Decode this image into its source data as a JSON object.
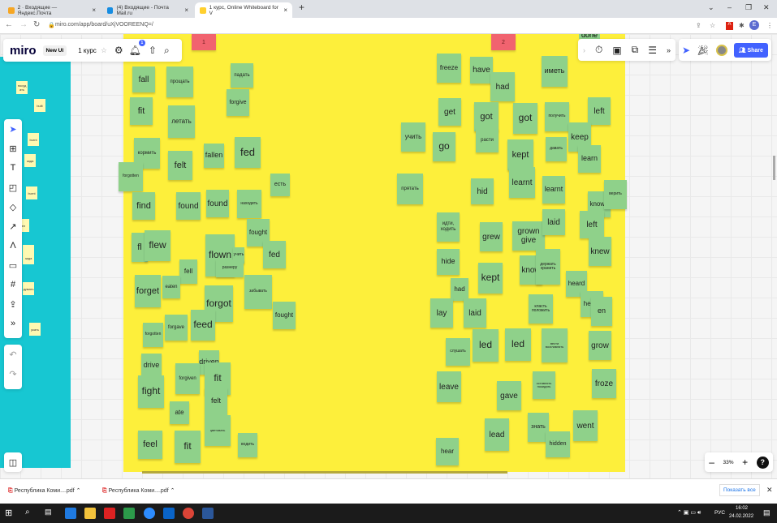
{
  "browser": {
    "tabs": [
      {
        "label": "2 · Входящие — Яндекс.Почта"
      },
      {
        "label": "(4) Входящие - Почта Mail.ru"
      },
      {
        "label": "1 курс, Online Whiteboard for V"
      }
    ],
    "url": "miro.com/app/board/uXjVOOREENQ=/",
    "profile_initial": "E"
  },
  "miro": {
    "logo": "miro",
    "badge": "New UI",
    "board_name": "1 курс",
    "notification_count": "1",
    "share_label": "Share",
    "zoom": "33%",
    "help": "?"
  },
  "frames": {
    "red1": "1",
    "red2": "2",
    "done": "done"
  },
  "stickies": [
    "fall",
    "прощать",
    "падать",
    "forgive",
    "fit",
    "летать",
    "кормить",
    "felt",
    "fallen",
    "fed",
    "forgotten",
    "есть",
    "find",
    "found",
    "found",
    "находить",
    "fought",
    "fl",
    "flew",
    "flown",
    "учить",
    "fed",
    "разнеру",
    "fell",
    "forget",
    "eaten",
    "забывать",
    "forgot",
    "fought",
    "forgave",
    "feed",
    "forgotten",
    "drive",
    "driven",
    "fight",
    "forgiven",
    "fit",
    "felt",
    "ate",
    "цветовать",
    "feel",
    "fit",
    "водить",
    "freeze",
    "have",
    "had",
    "иметь",
    "get",
    "got",
    "got",
    "получить",
    "left",
    "учить",
    "go",
    "расти",
    "kept",
    "keep",
    "давать",
    "learn",
    "прятать",
    "hid",
    "learnt",
    "learnt",
    "known",
    "верить",
    "идти, ходить",
    "grew",
    "grown give",
    "laid",
    "left",
    "knew",
    "hide",
    "kept",
    "know",
    "держать хранить",
    "had",
    "heard",
    "lay",
    "laid",
    "класть положить",
    "heard",
    "en",
    "слушать",
    "led",
    "led",
    "вести возглавлять",
    "grow",
    "leave",
    "gave",
    "оставлять покидать",
    "froze",
    "lead",
    "знать",
    "went",
    "hidden",
    "hear"
  ],
  "mini_stickies": [
    "посуд ать",
    "built",
    "burnt",
    "зада",
    "burnt",
    "ел",
    "ать",
    "думать",
    "укать",
    "зада"
  ],
  "downloads": {
    "items": [
      "Республика Коми....pdf",
      "Республика Коми....pdf"
    ],
    "show_all": "Показать все"
  },
  "taskbar": {
    "lang": "РУС",
    "time": "16:02",
    "date": "24.02.2022"
  }
}
